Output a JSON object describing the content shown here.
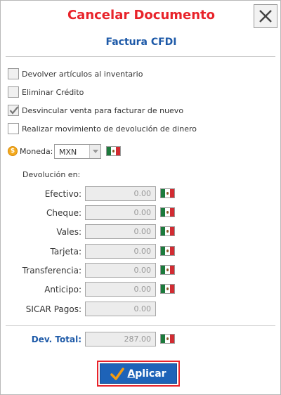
{
  "window": {
    "title": "Cancelar Documento",
    "subtitle": "Factura CFDI"
  },
  "options": [
    {
      "label": "Devolver artículos al inventario",
      "checked": false
    },
    {
      "label": "Eliminar Crédito",
      "checked": false
    },
    {
      "label": "Desvincular venta para facturar de nuevo",
      "checked": true
    },
    {
      "label": "Realizar movimiento de devolución de dinero",
      "checked": false
    }
  ],
  "currency": {
    "label": "Moneda:",
    "selected": "MXN",
    "coin_symbol": "$"
  },
  "refund": {
    "heading": "Devolución en:",
    "rows": [
      {
        "label": "Efectivo:",
        "value": "0.00",
        "flag": true
      },
      {
        "label": "Cheque:",
        "value": "0.00",
        "flag": true
      },
      {
        "label": "Vales:",
        "value": "0.00",
        "flag": true
      },
      {
        "label": "Tarjeta:",
        "value": "0.00",
        "flag": true
      },
      {
        "label": "Transferencia:",
        "value": "0.00",
        "flag": true
      },
      {
        "label": "Anticipo:",
        "value": "0.00",
        "flag": true
      },
      {
        "label": "SICAR Pagos:",
        "value": "0.00",
        "flag": false
      }
    ],
    "total_label": "Dev. Total:",
    "total_value": "287.00"
  },
  "actions": {
    "apply_first": "A",
    "apply_rest": "plicar"
  },
  "colors": {
    "title": "#e8232a",
    "accent": "#1e5aa8",
    "button": "#1e63b8",
    "check": "#f39c12"
  }
}
